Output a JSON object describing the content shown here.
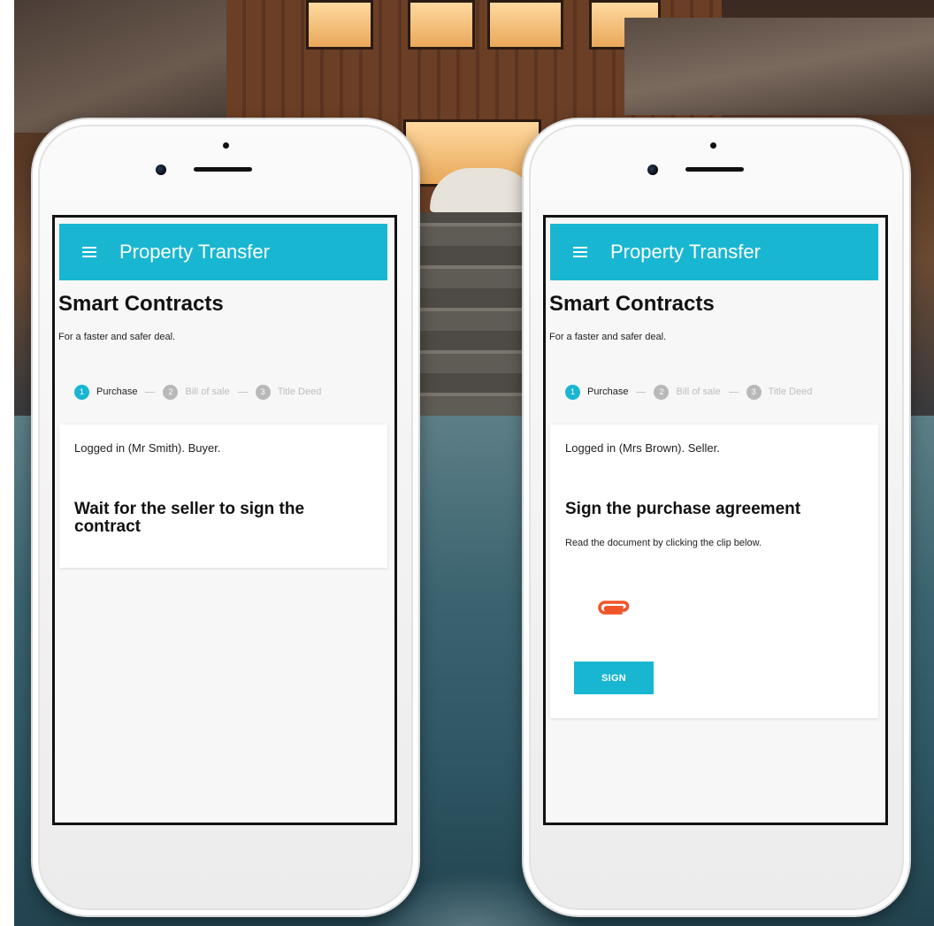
{
  "phones": [
    {
      "app_title": "Property Transfer",
      "page_title": "Smart Contracts",
      "page_subtitle": "For a faster and safer deal.",
      "steps": [
        {
          "number": "1",
          "label": "Purchase"
        },
        {
          "number": "2",
          "label": "Bill of sale"
        },
        {
          "number": "3",
          "label": "Title Deed"
        }
      ],
      "card": {
        "logged_in": "Logged in (Mr Smith). Buyer.",
        "heading": "Wait for the seller to sign the contract"
      }
    },
    {
      "app_title": "Property Transfer",
      "page_title": "Smart Contracts",
      "page_subtitle": "For a faster and safer deal.",
      "steps": [
        {
          "number": "1",
          "label": "Purchase"
        },
        {
          "number": "2",
          "label": "Bill of sale"
        },
        {
          "number": "3",
          "label": "Title Deed"
        }
      ],
      "card": {
        "logged_in": "Logged in (Mrs Brown). Seller.",
        "heading": "Sign the purchase agreement",
        "note": "Read the document by clicking the clip below.",
        "attachment_icon": "paperclip-icon",
        "sign_label": "SIGN"
      }
    }
  ],
  "colors": {
    "accent": "#19b6d2",
    "clip": "#f0552a"
  }
}
